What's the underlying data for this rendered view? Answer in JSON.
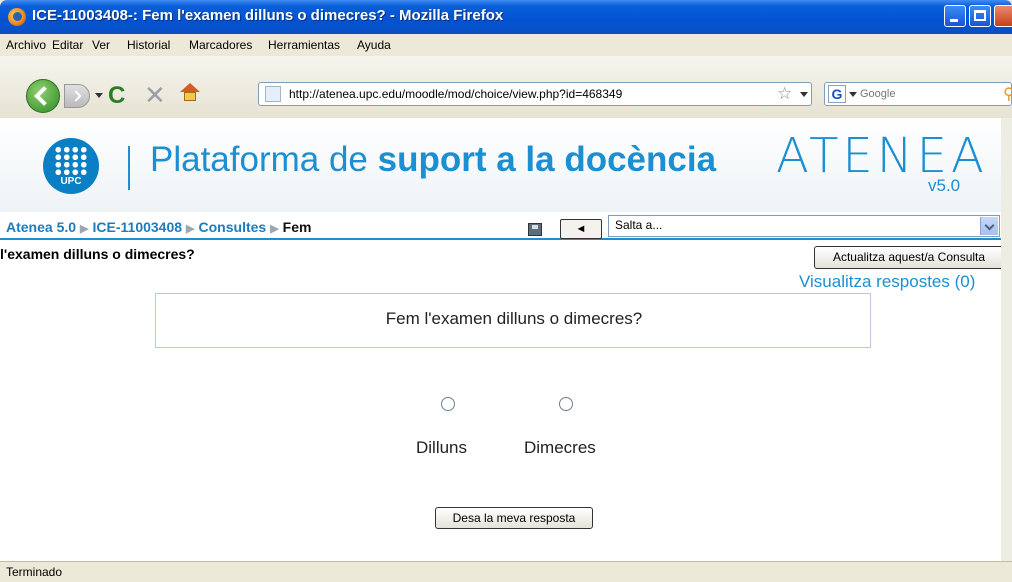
{
  "window": {
    "title": "ICE-11003408-: Fem l'examen dilluns o dimecres? - Mozilla Firefox"
  },
  "menu": [
    "Archivo",
    "Editar",
    "Ver",
    "Historial",
    "Marcadores",
    "Herramientas",
    "Ayuda"
  ],
  "address_bar": {
    "url": "http://atenea.upc.edu/moodle/mod/choice/view.php?id=468349"
  },
  "search_bar": {
    "placeholder": "Google"
  },
  "banner": {
    "logo_text": "UPC",
    "headline_plain": "Plataforma de ",
    "headline_bold": "suport a la docència",
    "brand": "ATENEA",
    "version": "v5.0"
  },
  "breadcrumb": {
    "items": [
      "Atenea 5.0",
      "ICE-11003408",
      "Consultes"
    ],
    "current": "Fem",
    "jump_select_value": "Salta a...",
    "prev_label": "◄"
  },
  "page": {
    "title": "l'examen dilluns o dimecres?",
    "update_button": "Actualitza aquest/a Consulta",
    "view_responses_link": "Visualitza respostes (0)",
    "question": "Fem l'examen dilluns o dimecres?",
    "options": [
      "Dilluns",
      "Dimecres"
    ],
    "submit_button": "Desa la meva resposta"
  },
  "status_bar": {
    "text": "Terminado"
  }
}
